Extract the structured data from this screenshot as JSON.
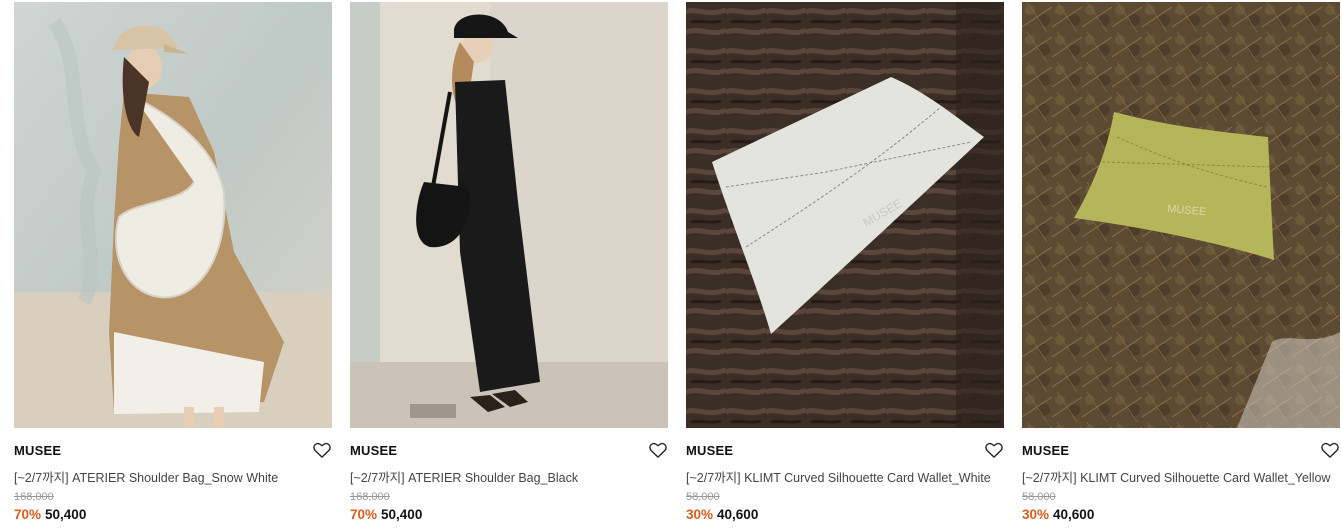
{
  "colors": {
    "discount": "#e35b1b",
    "text": "#111111",
    "muted": "#999999"
  },
  "products": [
    {
      "brand": "MUSEE",
      "name": "[~2/7까지] ATERIER Shoulder Bag_Snow White",
      "original_price": "168,000",
      "discount": "70%",
      "price": "50,400",
      "wishlist_icon": "heart-outline-icon"
    },
    {
      "brand": "MUSEE",
      "name": "[~2/7까지] ATERIER Shoulder Bag_Black",
      "original_price": "168,000",
      "discount": "70%",
      "price": "50,400",
      "wishlist_icon": "heart-outline-icon"
    },
    {
      "brand": "MUSEE",
      "name": "[~2/7까지] KLIMT Curved Silhouette Card Wallet_White",
      "original_price": "58,000",
      "discount": "30%",
      "price": "40,600",
      "wishlist_icon": "heart-outline-icon"
    },
    {
      "brand": "MUSEE",
      "name": "[~2/7까지] KLIMT Curved Silhouette Card Wallet_Yellow",
      "original_price": "58,000",
      "discount": "30%",
      "price": "40,600",
      "wishlist_icon": "heart-outline-icon"
    }
  ]
}
